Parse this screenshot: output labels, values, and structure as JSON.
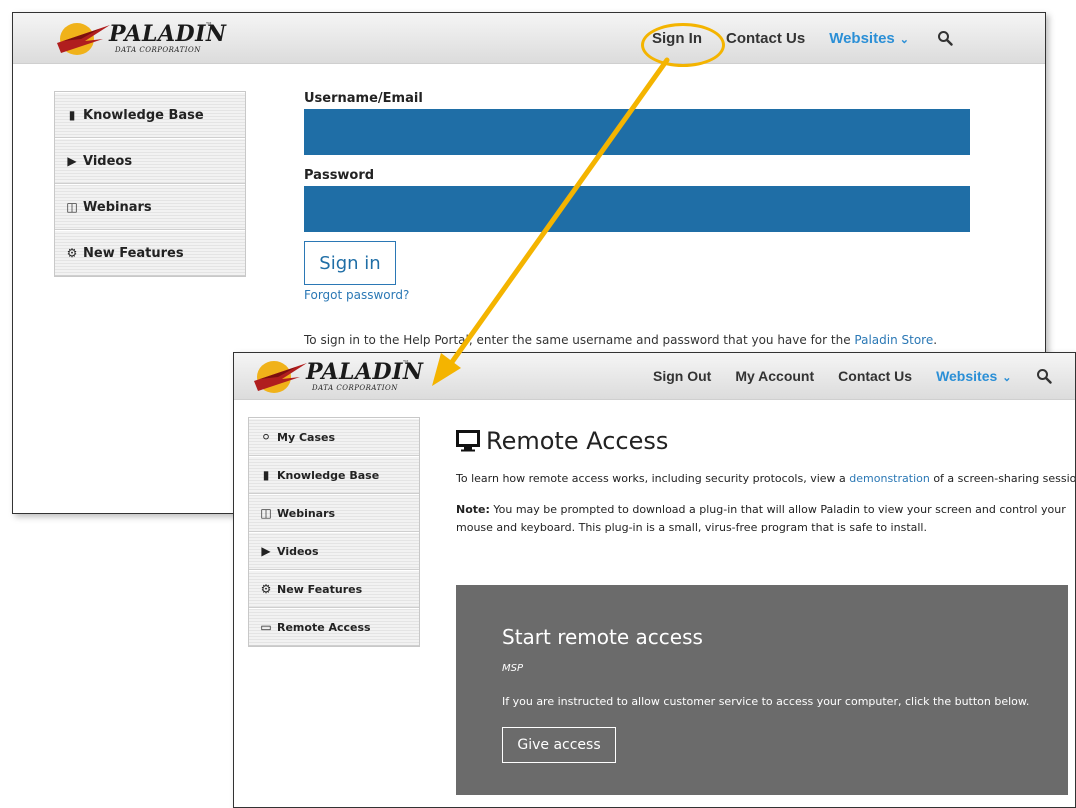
{
  "login_page": {
    "logo": {
      "name": "PALADIN",
      "tm": "™",
      "sub": "DATA CORPORATION"
    },
    "nav": {
      "sign_in": "Sign In",
      "contact": "Contact Us",
      "websites": "Websites"
    },
    "sidebar": [
      {
        "label": "Knowledge Base",
        "icon": "book-icon"
      },
      {
        "label": "Videos",
        "icon": "video-icon"
      },
      {
        "label": "Webinars",
        "icon": "webinar-icon"
      },
      {
        "label": "New Features",
        "icon": "gear-icon"
      }
    ],
    "form": {
      "username_label": "Username/Email",
      "password_label": "Password",
      "signin_button": "Sign in",
      "forgot": "Forgot password?"
    },
    "note": {
      "pre": "To sign in to the Help Portal, enter the same username and password that you have for the ",
      "link": "Paladin Store",
      "post": "."
    }
  },
  "remote_page": {
    "logo": {
      "name": "PALADIN",
      "tm": "™",
      "sub": "DATA CORPORATION"
    },
    "nav": {
      "sign_out": "Sign Out",
      "account": "My Account",
      "contact": "Contact Us",
      "websites": "Websites"
    },
    "sidebar": [
      {
        "label": "My Cases",
        "icon": "globe-icon"
      },
      {
        "label": "Knowledge Base",
        "icon": "book-icon"
      },
      {
        "label": "Webinars",
        "icon": "webinar-icon"
      },
      {
        "label": "Videos",
        "icon": "video-icon"
      },
      {
        "label": "New Features",
        "icon": "gear-icon"
      },
      {
        "label": "Remote Access",
        "icon": "monitor-icon"
      }
    ],
    "title": "Remote Access",
    "intro": {
      "pre": "To learn how remote access works, including security protocols, view a ",
      "link": "demonstration",
      "post": " of a screen-sharing session."
    },
    "note": {
      "label": "Note:",
      "text": " You may be prompted to download a plug-in that will allow Paladin to view your screen and control your mouse and keyboard. This plug-in is a small, virus-free program that is safe to install."
    },
    "access": {
      "title": "Start remote access",
      "subtitle": "MSP",
      "desc": "If you are instructed to allow customer service to access your computer, click the button below.",
      "button": "Give access"
    }
  },
  "colors": {
    "accent_blue": "#2b8fd6",
    "input_blue": "#1f6ea6",
    "callout_yellow": "#f4b400",
    "access_box_grey": "#6b6b6b"
  }
}
